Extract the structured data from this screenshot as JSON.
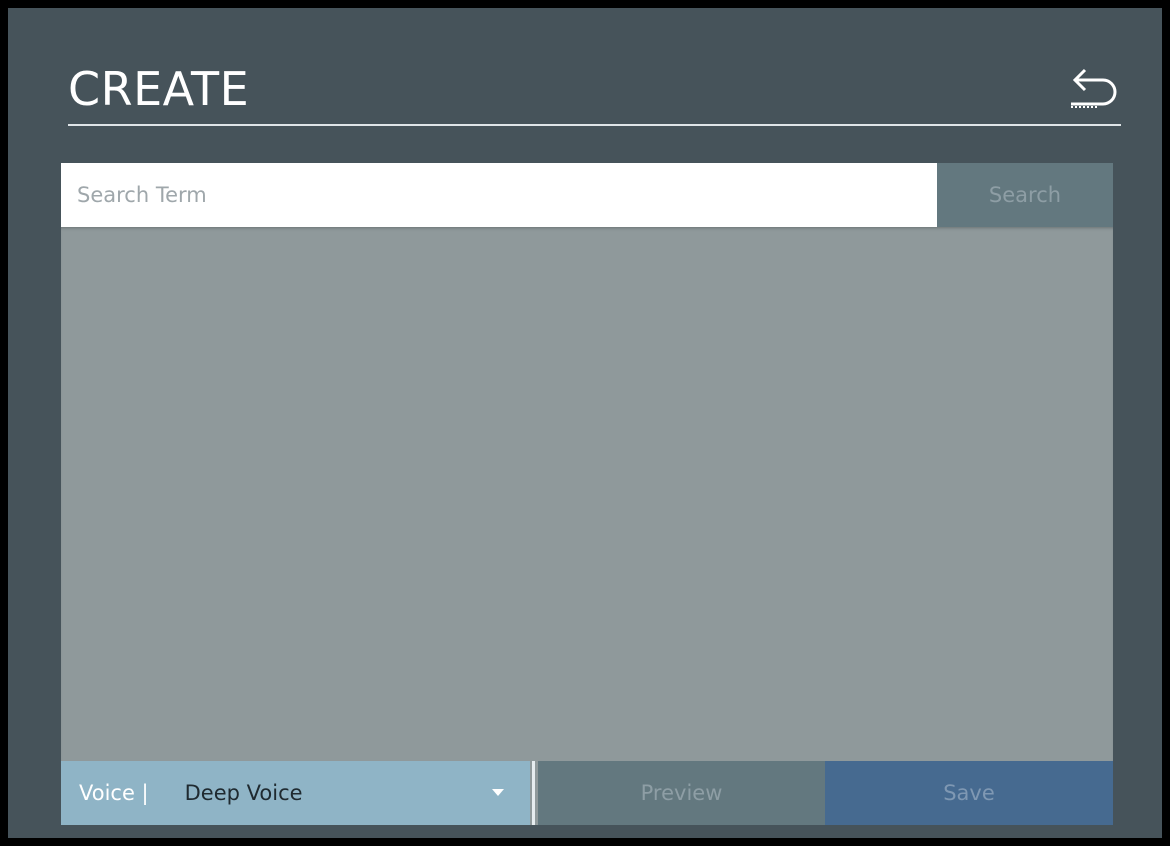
{
  "header": {
    "title": "CREATE",
    "back_icon": "back-arrow-icon"
  },
  "search": {
    "placeholder": "Search Term",
    "value": "",
    "button_label": "Search"
  },
  "voice": {
    "label": "Voice |",
    "selected": "Deep Voice",
    "dropdown_icon": "chevron-down-icon"
  },
  "actions": {
    "preview_label": "Preview",
    "save_label": "Save"
  },
  "colors": {
    "window_bg": "#46535a",
    "results_bg": "#8f999b",
    "voice_bg": "#8fb4c6",
    "preview_bg": "#63787f",
    "save_bg": "#466a90"
  }
}
